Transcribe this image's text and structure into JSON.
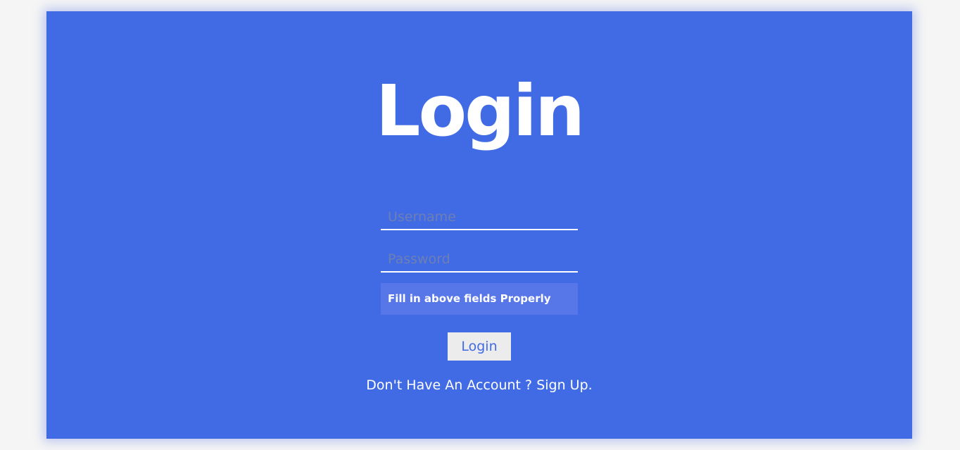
{
  "colors": {
    "page_background": "#f5f5f5",
    "card_background": "#416be4",
    "alert_background": "#5776e7",
    "button_background": "#ececec",
    "button_text": "#416be4",
    "text": "#ffffff"
  },
  "login_form": {
    "title": "Login",
    "username": {
      "value": "",
      "placeholder": "Username"
    },
    "password": {
      "value": "",
      "placeholder": "Password"
    },
    "alert_message": "Fill in above fields Properly",
    "submit_label": "Login",
    "signup_prompt": "Don't Have An Account ?",
    "signup_link": "Sign Up."
  }
}
